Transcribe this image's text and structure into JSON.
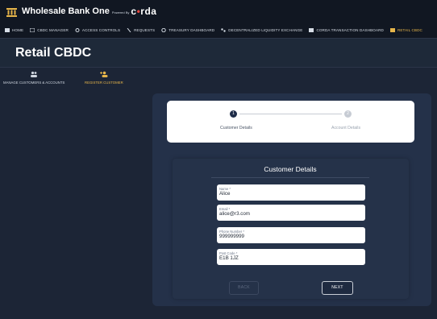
{
  "app": {
    "title": "Wholesale Bank One",
    "powered_by": "Powered By",
    "brand_prefix": "c",
    "brand_mid": "•",
    "brand_suffix": "rda"
  },
  "nav": {
    "items": [
      {
        "label": "HOME",
        "icon": "home-icon"
      },
      {
        "label": "CBDC MANAGER",
        "icon": "cbdc-icon"
      },
      {
        "label": "ACCESS CONTROLS",
        "icon": "gear-icon"
      },
      {
        "label": "REQUESTS",
        "icon": "requests-icon"
      },
      {
        "label": "TREASURY DASHBOARD",
        "icon": "treasury-icon"
      },
      {
        "label": "DECENTRALIZED LIQUIDITY EXCHANGE",
        "icon": "exchange-icon"
      },
      {
        "label": "CORDA TRANSACTION DASHBOARD",
        "icon": "dashboard-icon"
      },
      {
        "label": "RETAIL CBDC",
        "icon": "retail-icon",
        "active": true
      }
    ]
  },
  "page": {
    "title": "Retail CBDC"
  },
  "subnav": {
    "manage": "MANAGE CUSTOMERS & ACCOUNTS",
    "register": "REGISTER CUSTOMER"
  },
  "stepper": {
    "step1_number": "1",
    "step1_label": "Customer Details",
    "step2_number": "2",
    "step2_label": "Account Details"
  },
  "form": {
    "heading": "Customer Details",
    "name": {
      "label": "Name *",
      "value": "Alice"
    },
    "email": {
      "label": "Email *",
      "value": "alice@r3.com"
    },
    "phone": {
      "label": "Phone Number *",
      "value": "999999999"
    },
    "postcode": {
      "label": "Post Code *",
      "value": "E1B 1JZ"
    },
    "back_label": "BACK",
    "next_label": "NEXT"
  },
  "colors": {
    "accent": "#e6b54a",
    "brand_red": "#e8473f",
    "panel": "#243149",
    "background": "#1c2536"
  }
}
